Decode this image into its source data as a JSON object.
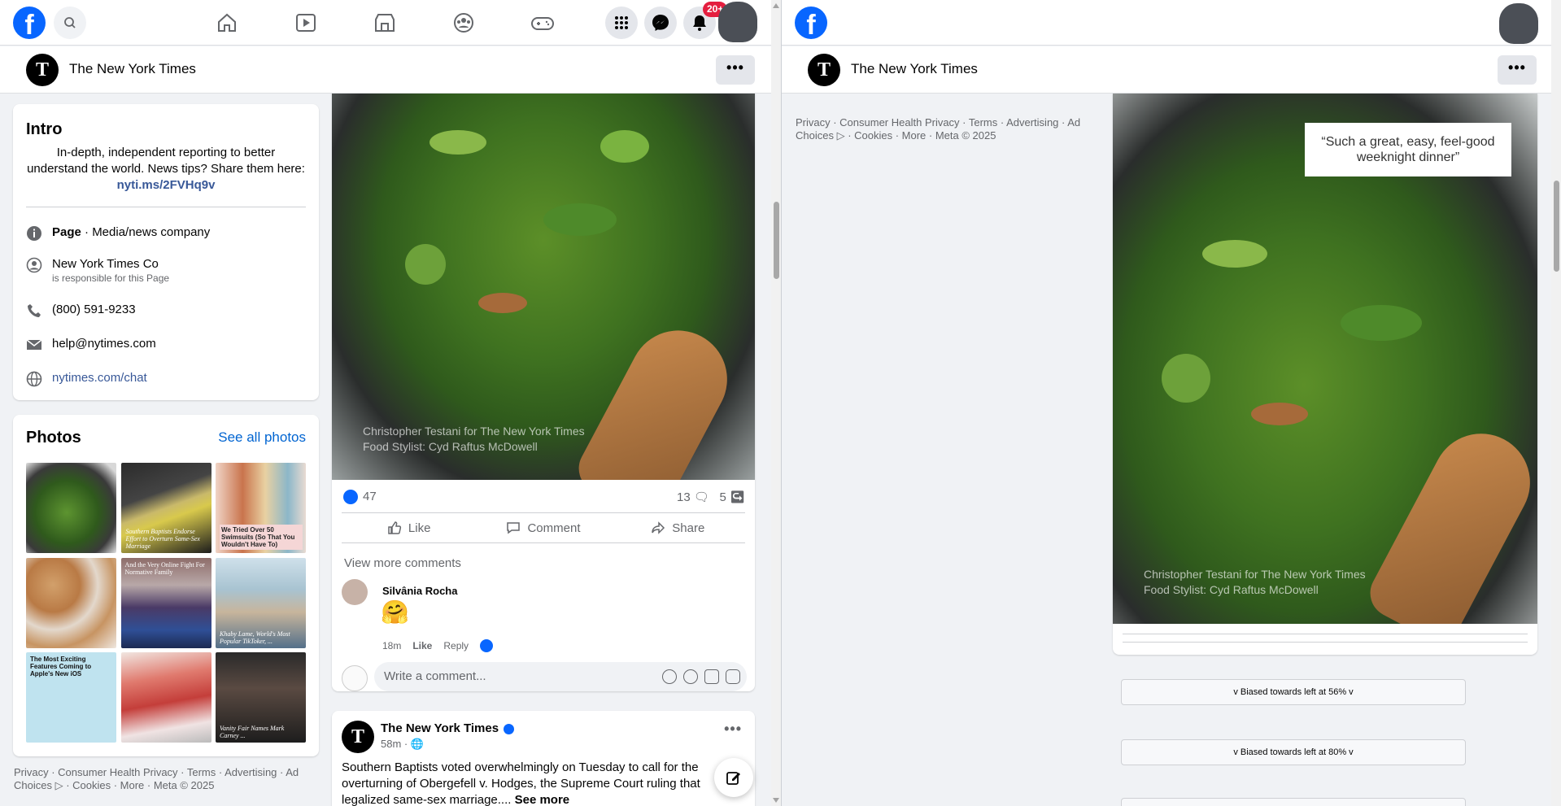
{
  "left": {
    "nav": {
      "logo": "f",
      "notifications_badge": "20+"
    },
    "page_header": {
      "logo_letter": "T",
      "name": "The New York Times",
      "more_label": "•••"
    },
    "intro": {
      "title": "Intro",
      "bio": "In-depth, independent reporting to better understand the world. News tips? Share them here:",
      "bio_link": "nyti.ms/2FVHq9v",
      "category_bold": "Page",
      "category_rest": " · Media/news company",
      "owner": "New York Times Co",
      "owner_sub": "is responsible for this Page",
      "phone": "(800) 591-9233",
      "email": "help@nytimes.com",
      "website": "nytimes.com/chat"
    },
    "photos": {
      "title": "Photos",
      "see_all": "See all photos",
      "captions": [
        "",
        "Southern Baptists Endorse Effort to Overturn Same-Sex Marriage",
        "We Tried Over 50 Swimsuits (So That You Wouldn't Have To)",
        "",
        "And the Very Online Fight For Normative Family",
        "Khaby Lame, World's Most Popular TikToker, ...",
        "The Most Exciting Features Coming to Apple's New iOS",
        "",
        "Vanity Fair Names Mark Carney ..."
      ]
    },
    "footer": "Privacy · Consumer Health Privacy · Terms · Advertising · Ad Choices ▷ · Cookies · More · Meta © 2025",
    "post": {
      "credit_line1": "Christopher Testani for The New York Times",
      "credit_line2": "Food Stylist: Cyd Raftus McDowell",
      "likes": "47",
      "comments_count": "13",
      "shares_count": "5",
      "like_label": "Like",
      "comment_label": "Comment",
      "share_label": "Share",
      "view_more": "View more comments",
      "commenter": "Silvânia Rocha",
      "comment_emoji": "🤗",
      "comment_time": "18m",
      "comment_like": "Like",
      "comment_reply": "Reply",
      "write_placeholder": "Write a comment..."
    },
    "next_post": {
      "name": "The New York Times",
      "time": "58m · 🌐",
      "text": "Southern Baptists voted overwhelmingly on Tuesday to call for the overturning of Obergefell v. Hodges, the Supreme Court ruling that legalized same-sex marriage....",
      "see_more": "See more"
    }
  },
  "right": {
    "nav": {
      "logo": "f"
    },
    "page_header": {
      "logo_letter": "T",
      "name": "The New York Times",
      "more_label": "•••"
    },
    "footer": "Privacy · Consumer Health Privacy · Terms · Advertising · Ad Choices ▷ · Cookies · More · Meta © 2025",
    "quote": "“Such a great, easy, feel-good weeknight dinner”",
    "credit_line1": "Christopher Testani for The New York Times",
    "credit_line2": "Food Stylist: Cyd Raftus McDowell",
    "buttons": [
      "v Biased towards left at 56% v",
      "v Biased towards left at 80% v"
    ]
  },
  "colors": {
    "brand_blue": "#0866ff",
    "link_blue": "#385898",
    "background": "#f0f2f5"
  }
}
